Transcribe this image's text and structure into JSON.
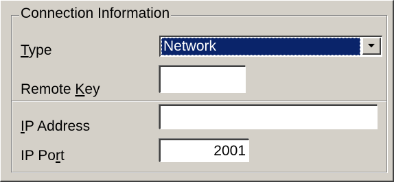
{
  "groupbox": {
    "title": "Connection Information"
  },
  "type_field": {
    "label_prefix": "",
    "label_mnemonic": "T",
    "label_suffix": "ype",
    "selected_value": "Network",
    "dropdown_icon": "chevron-down-icon"
  },
  "remote_key_field": {
    "label_prefix": "Remote ",
    "label_mnemonic": "K",
    "label_suffix": "ey",
    "value": ""
  },
  "ip_address_field": {
    "label_prefix": "",
    "label_mnemonic": "I",
    "label_suffix": "P Address",
    "value": ""
  },
  "ip_port_field": {
    "label_prefix": "IP Po",
    "label_mnemonic": "r",
    "label_suffix": "t",
    "value": "2001"
  }
}
